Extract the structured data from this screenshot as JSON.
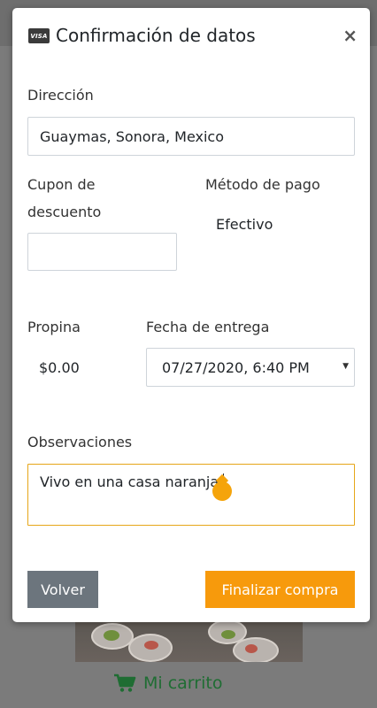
{
  "modal": {
    "title": "Confirmación de datos",
    "close_symbol": "×",
    "card_icon_text": "VISA"
  },
  "form": {
    "address": {
      "label": "Dirección",
      "value": "Guaymas, Sonora, Mexico"
    },
    "coupon": {
      "label_line1": "Cupon de",
      "label_line2": "descuento",
      "value": ""
    },
    "payment": {
      "label": "Método de pago",
      "value": "Efectivo"
    },
    "tip": {
      "label": "Propina",
      "value": "$0.00"
    },
    "delivery_date": {
      "label": "Fecha de entrega",
      "value": "07/27/2020, 6:40 PM"
    },
    "notes": {
      "label": "Observaciones",
      "value": "Vivo en una casa naranja."
    }
  },
  "actions": {
    "back_label": "Volver",
    "finish_label": "Finalizar compra"
  },
  "background": {
    "cart_label": "Mi carrito"
  },
  "colors": {
    "accent_orange": "#f79a0c",
    "secondary_gray": "#6c757d",
    "cart_green": "#1f6d33",
    "focus_border": "#e6a619"
  },
  "icons": [
    "credit-card-icon",
    "close-icon",
    "chevron-down-icon",
    "shopping-cart-icon",
    "text-cursor-handle-icon"
  ]
}
